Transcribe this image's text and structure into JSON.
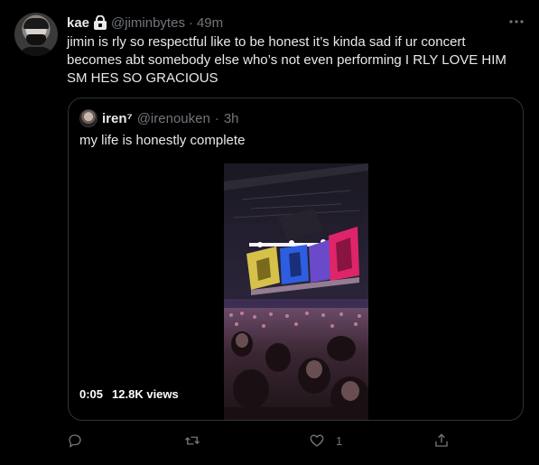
{
  "tweet": {
    "display_name": "kae",
    "handle": "@jiminbytes",
    "separator": "·",
    "time": "49m",
    "text": "jimin is rly so respectful like to be honest it’s kinda sad if ur concert becomes abt somebody else who’s not even performing I RLY LOVE HIM SM HES SO GRACIOUS",
    "icons": {
      "lock": "lock-icon",
      "more": "more-icon"
    }
  },
  "quote": {
    "display_name": "iren⁷",
    "handle": "@irenouken",
    "separator": "·",
    "time": "3h",
    "text": "my life is honestly complete",
    "video": {
      "duration": "0:05",
      "views": "12.8K views"
    }
  },
  "actions": {
    "reply_count": "",
    "retweet_count": "",
    "like_count": "1",
    "icons": [
      "reply-icon",
      "retweet-icon",
      "like-icon",
      "share-icon"
    ]
  },
  "colors": {
    "background": "#000000",
    "text_primary": "#e7e9ea",
    "text_secondary": "#71767b",
    "border": "#2f3336"
  }
}
